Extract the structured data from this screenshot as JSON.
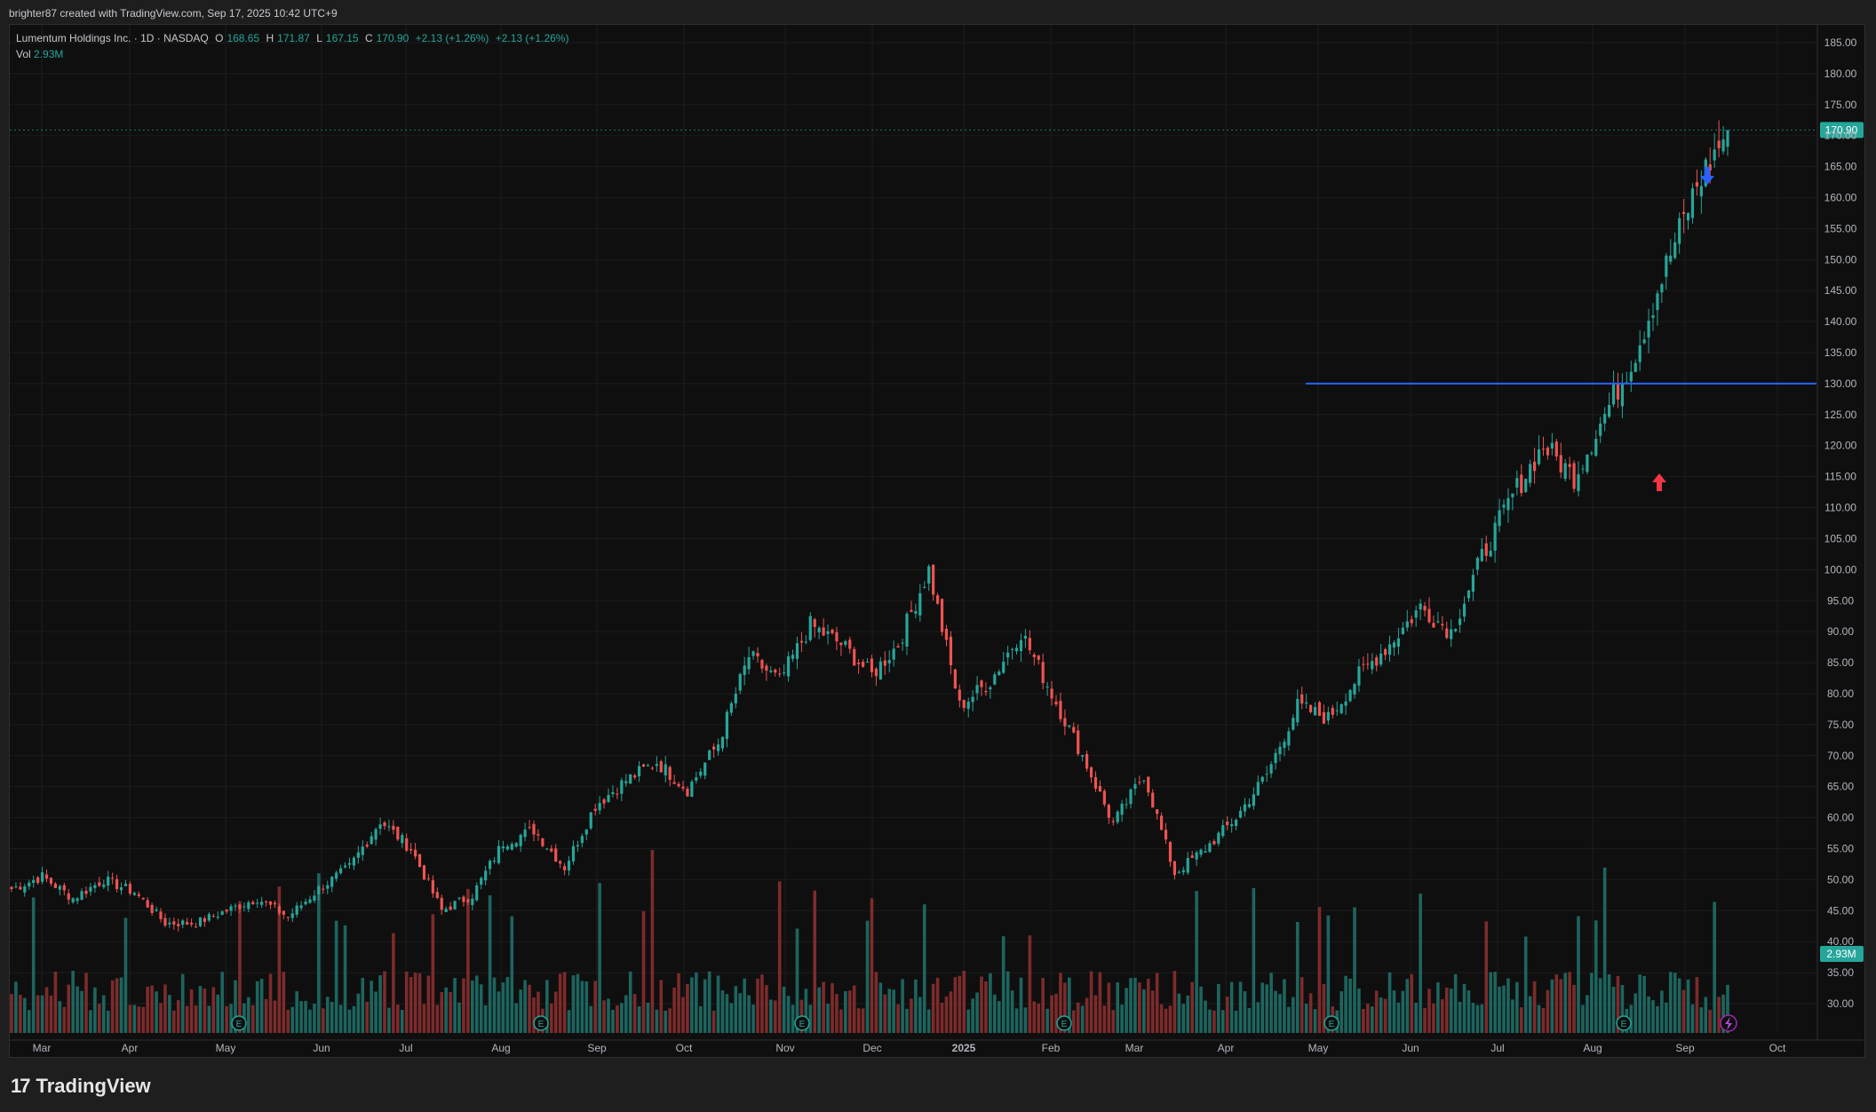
{
  "header": {
    "created_by": "brighter87 created with TradingView.com, Sep 17, 2025 10:42 UTC+9"
  },
  "legend": {
    "symbol": "Lumentum Holdings Inc. · 1D · NASDAQ",
    "o_label": "O",
    "o_value": "168.65",
    "h_label": "H",
    "h_value": "171.87",
    "l_label": "L",
    "l_value": "167.15",
    "c_label": "C",
    "c_value": "170.90",
    "change": "+2.13 (+1.26%)",
    "change2": "+2.13 (+1.26%)",
    "vol_label": "Vol",
    "vol_value": "2.93M"
  },
  "price_badge": "170.90",
  "volume_badge": "2.93M",
  "brand": {
    "logo_text": "17",
    "name": "TradingView"
  },
  "colors": {
    "up": "#26a69a",
    "down": "#ef5350",
    "hline": "#2962ff",
    "background": "#0f0f0f"
  },
  "chart_data": {
    "type": "candlestick",
    "ylim": [
      25,
      187.5
    ],
    "y_ticks": [
      "185.00",
      "180.00",
      "175.00",
      "170.00",
      "165.00",
      "160.00",
      "155.00",
      "150.00",
      "145.00",
      "140.00",
      "135.00",
      "130.00",
      "125.00",
      "120.00",
      "115.00",
      "110.00",
      "105.00",
      "100.00",
      "95.00",
      "90.00",
      "85.00",
      "80.00",
      "75.00",
      "70.00",
      "65.00",
      "60.00",
      "55.00",
      "50.00",
      "45.00",
      "40.00",
      "35.00",
      "30.00"
    ],
    "x_ticks": [
      "Mar",
      "Apr",
      "May",
      "Jun",
      "Jul",
      "Aug",
      "Sep",
      "Oct",
      "Nov",
      "Dec",
      "2025",
      "Feb",
      "Mar",
      "Apr",
      "May",
      "Jun",
      "Jul",
      "Aug",
      "Sep",
      "Oct"
    ],
    "last_close": 170.9,
    "horizontal_line": 130,
    "price_path": [
      {
        "x": "Feb 20",
        "y": 48.5
      },
      {
        "x": "Mar 1",
        "y": 50.5
      },
      {
        "x": "Mar 10",
        "y": 47.0
      },
      {
        "x": "Mar 20",
        "y": 50.0
      },
      {
        "x": "Apr 1",
        "y": 48.0
      },
      {
        "x": "Apr 15",
        "y": 43.0
      },
      {
        "x": "May 1",
        "y": 43.0
      },
      {
        "x": "May 10",
        "y": 45.0
      },
      {
        "x": "May 20",
        "y": 47.0
      },
      {
        "x": "Jun 5",
        "y": 44.0
      },
      {
        "x": "Jun 20",
        "y": 48.5
      },
      {
        "x": "Jul 1",
        "y": 52.0
      },
      {
        "x": "Jul 12",
        "y": 59.5
      },
      {
        "x": "Jul 25",
        "y": 55.0
      },
      {
        "x": "Aug 5",
        "y": 45.0
      },
      {
        "x": "Aug 12",
        "y": 47.5
      },
      {
        "x": "Aug 20",
        "y": 56.0
      },
      {
        "x": "Sep 1",
        "y": 58.0
      },
      {
        "x": "Sep 10",
        "y": 52.0
      },
      {
        "x": "Sep 25",
        "y": 62.0
      },
      {
        "x": "Oct 5",
        "y": 66.0
      },
      {
        "x": "Oct 20",
        "y": 69.0
      },
      {
        "x": "Nov 1",
        "y": 64.5
      },
      {
        "x": "Nov 5",
        "y": 72.0
      },
      {
        "x": "Nov 8",
        "y": 86.0
      },
      {
        "x": "Nov 20",
        "y": 82.0
      },
      {
        "x": "Dec 1",
        "y": 91.0
      },
      {
        "x": "Dec 10",
        "y": 88.0
      },
      {
        "x": "Dec 15",
        "y": 83.0
      },
      {
        "x": "Dec 31",
        "y": 88.0
      },
      {
        "x": "Jan 15",
        "y": 100.0
      },
      {
        "x": "Jan 22",
        "y": 78.0
      },
      {
        "x": "Jan 28",
        "y": 82.0
      },
      {
        "x": "Feb 5",
        "y": 90.0
      },
      {
        "x": "Feb 15",
        "y": 80.0
      },
      {
        "x": "Mar 1",
        "y": 70.0
      },
      {
        "x": "Mar 15",
        "y": 59.0
      },
      {
        "x": "Apr 1",
        "y": 67.0
      },
      {
        "x": "Apr 10",
        "y": 51.0
      },
      {
        "x": "Apr 20",
        "y": 55.0
      },
      {
        "x": "May 1",
        "y": 60.0
      },
      {
        "x": "May 15",
        "y": 67.0
      },
      {
        "x": "May 25",
        "y": 78.0
      },
      {
        "x": "Jun 5",
        "y": 76.0
      },
      {
        "x": "Jun 20",
        "y": 83.0
      },
      {
        "x": "Jul 1",
        "y": 88.0
      },
      {
        "x": "Jul 10",
        "y": 94.0
      },
      {
        "x": "Jul 20",
        "y": 90.0
      },
      {
        "x": "Aug 1",
        "y": 102.0
      },
      {
        "x": "Aug 10",
        "y": 112.0
      },
      {
        "x": "Aug 15",
        "y": 120.0
      },
      {
        "x": "Aug 20",
        "y": 115.0
      },
      {
        "x": "Aug 28",
        "y": 125.0
      },
      {
        "x": "Sep 3",
        "y": 135.0
      },
      {
        "x": "Sep 8",
        "y": 149.0
      },
      {
        "x": "Sep 12",
        "y": 162.0
      },
      {
        "x": "Sep 16",
        "y": 170.9
      }
    ]
  }
}
